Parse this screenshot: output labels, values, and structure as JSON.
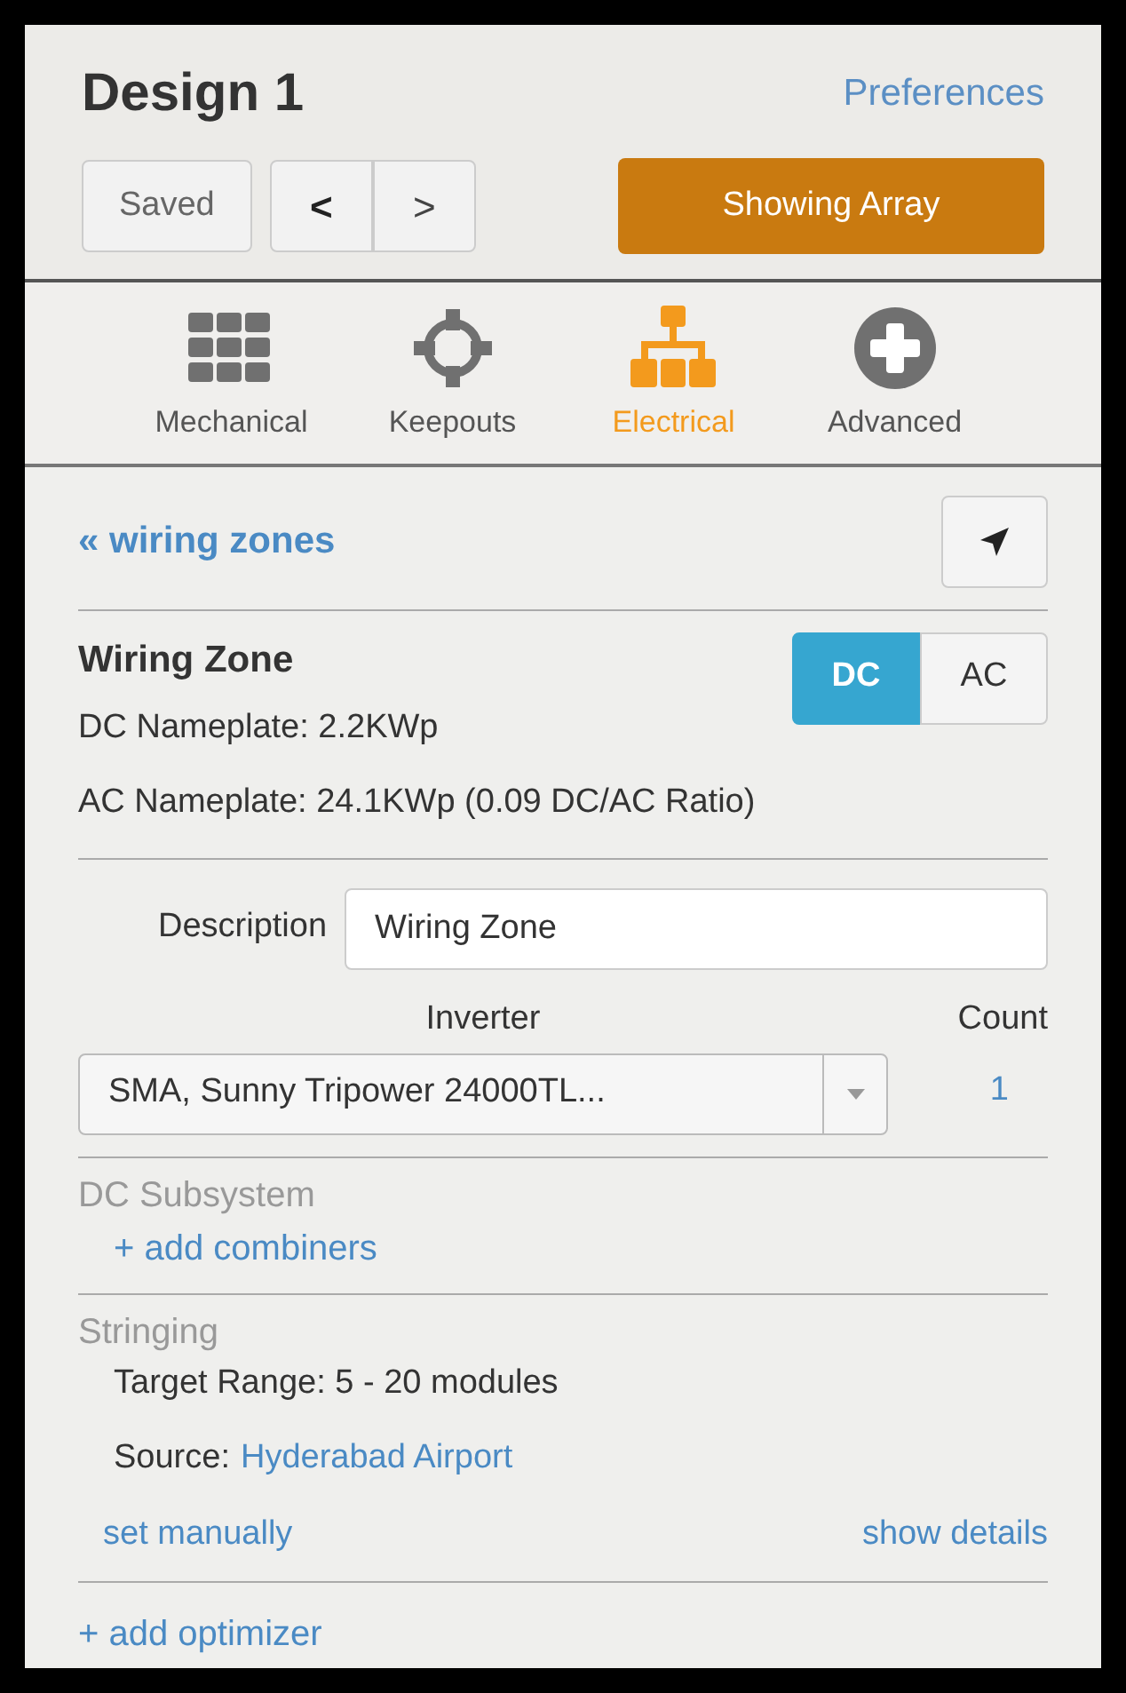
{
  "header": {
    "title": "Design 1",
    "preferences_link": "Preferences",
    "saved_button": "Saved",
    "nav_buttons": [
      {
        "kind": "back",
        "label": "<"
      },
      {
        "kind": "forward",
        "label": ">"
      }
    ],
    "show_button": "Showing Array"
  },
  "tools": [
    {
      "kind": "grid",
      "label": "Mechanical",
      "selected": false
    },
    {
      "kind": "crosshair",
      "label": "Keepouts",
      "selected": false
    },
    {
      "kind": "hierarchy",
      "label": "Electrical",
      "selected": true
    },
    {
      "kind": "plus",
      "label": "Advanced",
      "selected": false
    }
  ],
  "panel": {
    "back_link": "« wiring zones",
    "zone_title": "Wiring Zone",
    "modes": [
      {
        "label": "DC",
        "selected": true
      },
      {
        "label": "AC",
        "selected": false
      }
    ],
    "dc_nameplate": "DC Nameplate: 2.2KWp",
    "ac_nameplate": "AC Nameplate: 24.1KWp (0.09 DC/AC Ratio)",
    "description": {
      "label": "Description",
      "value": "Wiring Zone"
    },
    "inverter": {
      "label": "Inverter",
      "value": "SMA, Sunny Tripower 24000TL...",
      "count_label": "Count",
      "count": "1"
    },
    "dc_subsystem": {
      "title": "DC Subsystem",
      "link": "+ add combiners"
    },
    "stringing": {
      "title": "Stringing",
      "target_range": "Target Range: 5 - 20 modules",
      "source_label": "Source:",
      "source_link": "Hyderabad Airport",
      "set_manually": "set manually",
      "show_details": "show details"
    },
    "add_optimizer": "+ add optimizer"
  }
}
